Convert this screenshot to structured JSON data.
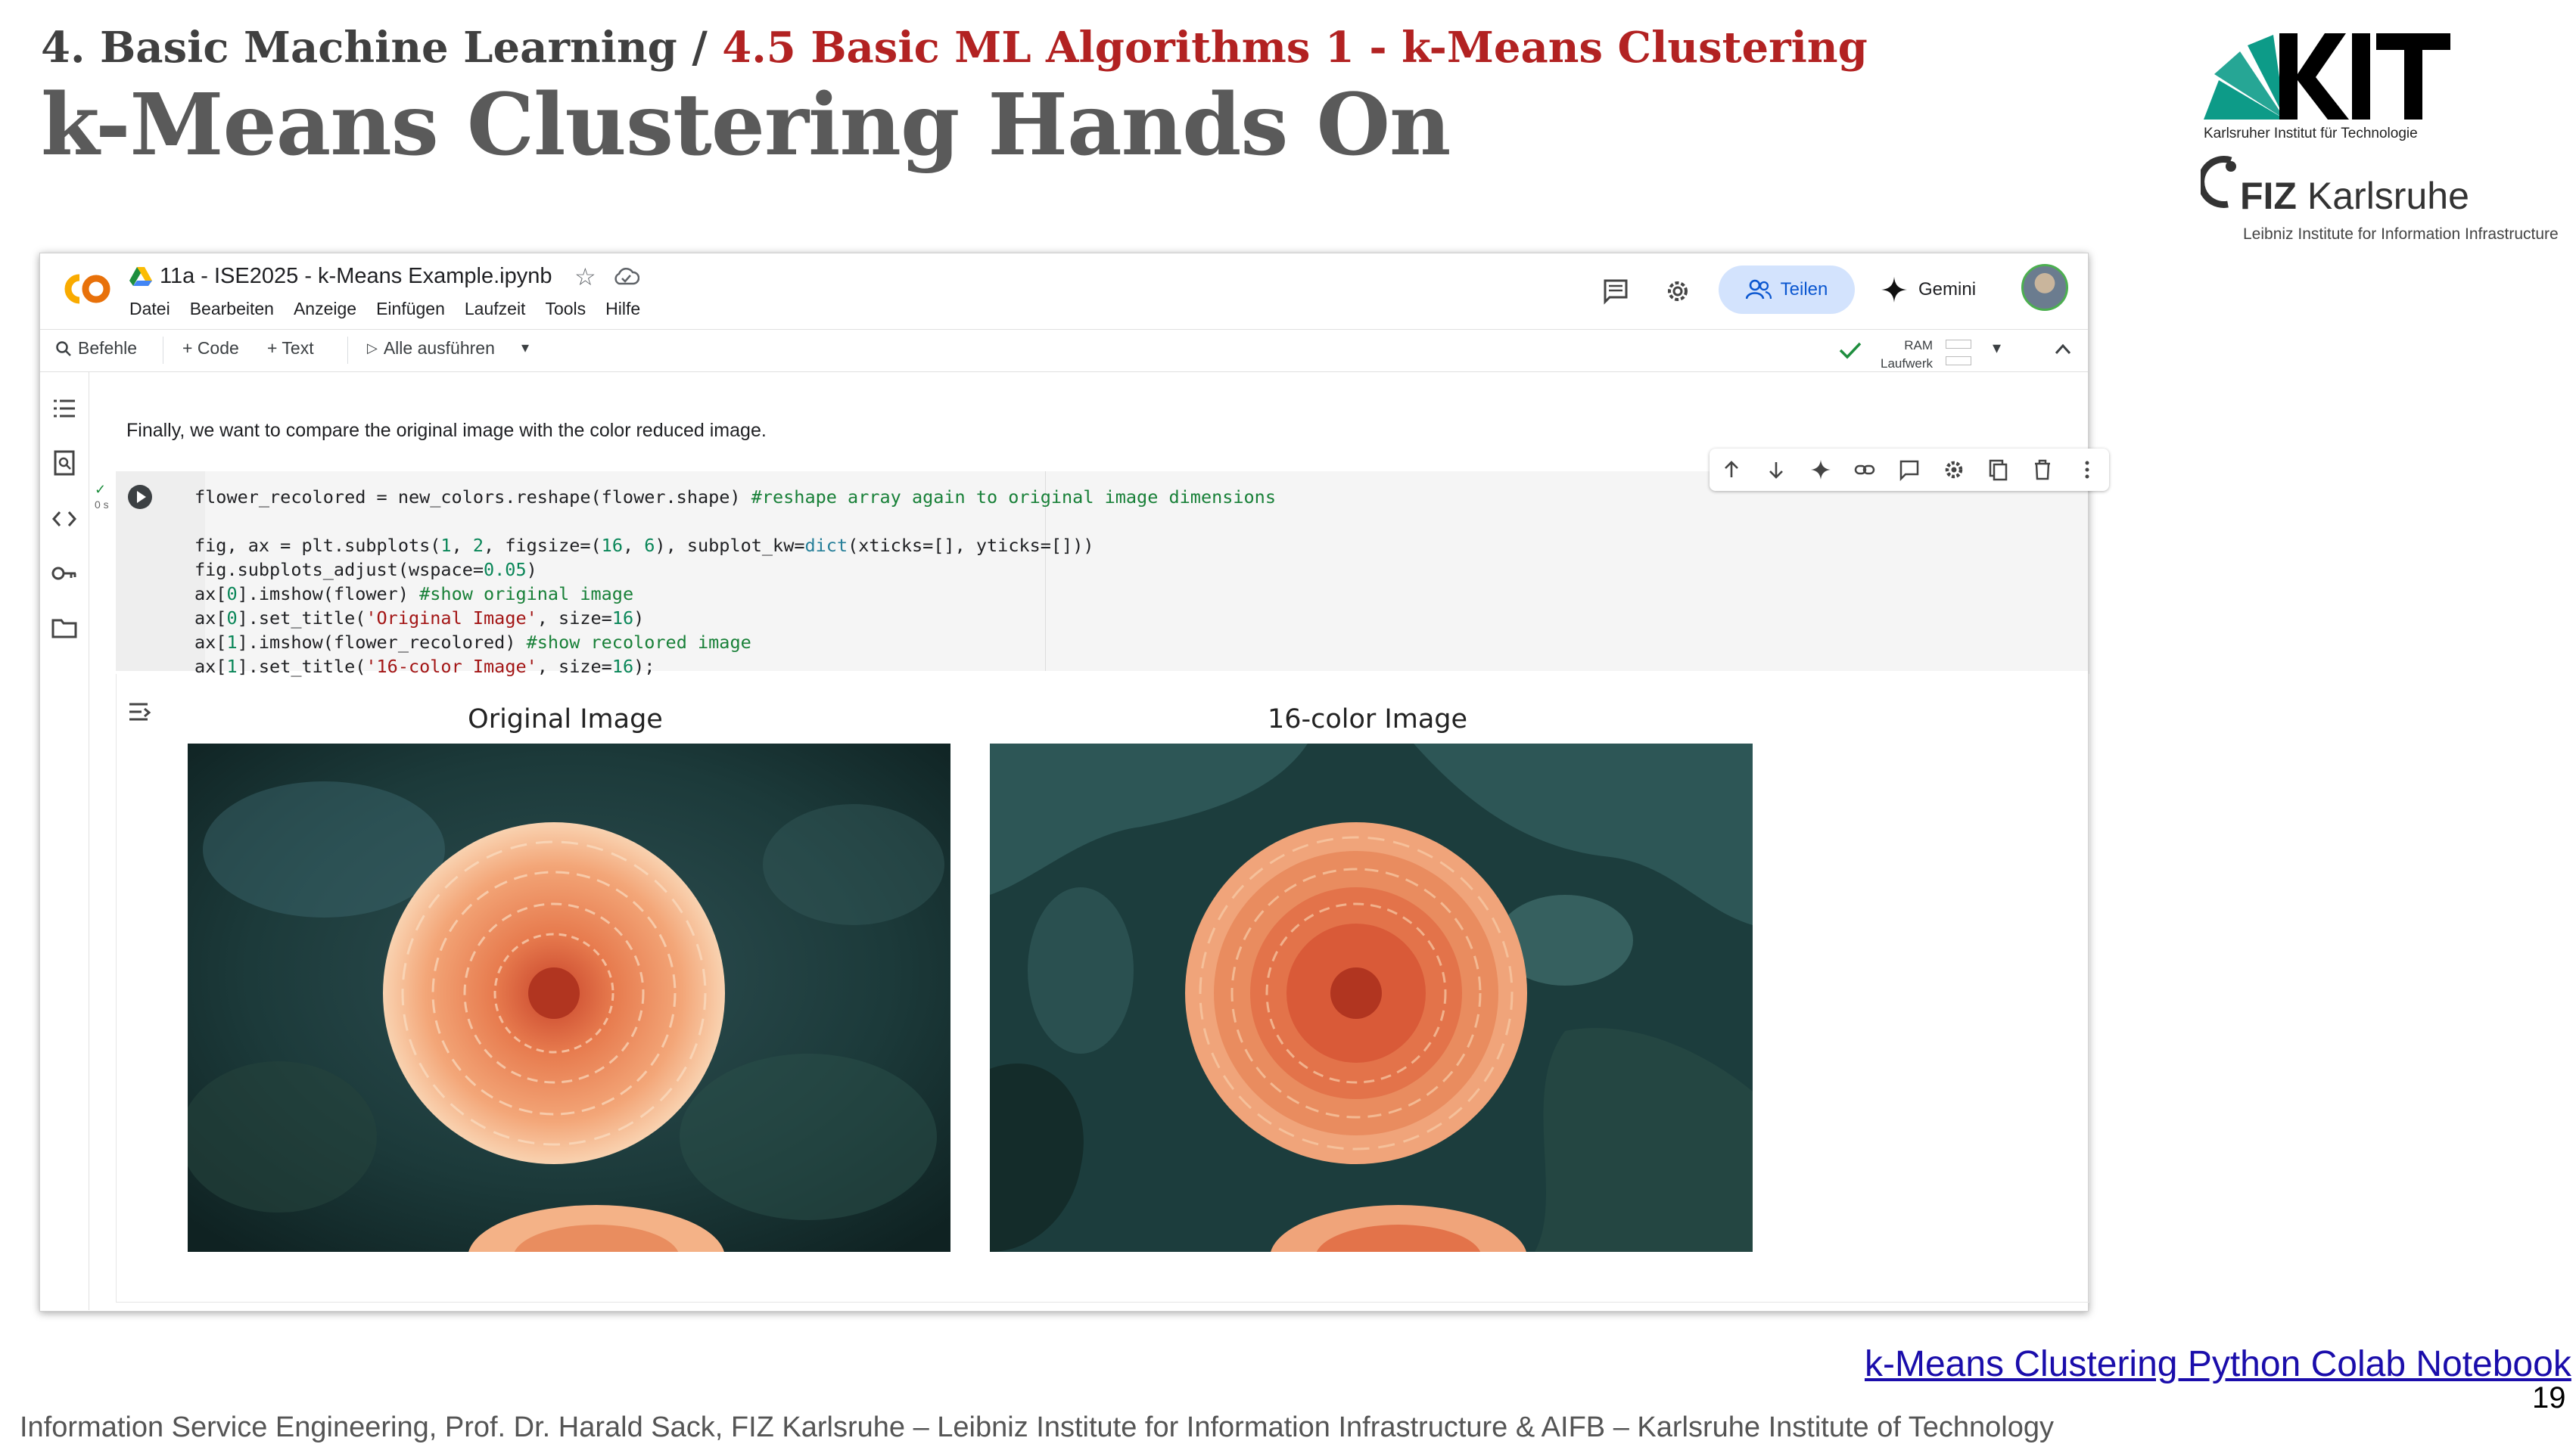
{
  "slide": {
    "breadcrumb_section": "4. Basic Machine Learning / ",
    "breadcrumb_topic": "4.5 Basic ML Algorithms 1 - k-Means Clustering",
    "title": "k-Means Clustering Hands On",
    "link_text": "k-Means Clustering Python Colab Notebook",
    "page_number": "19",
    "footer": "Information Service Engineering, Prof. Dr. Harald Sack, FIZ Karlsruhe – Leibniz Institute for Information Infrastructure & AIFB – Karlsruhe Institute of Technology"
  },
  "logos": {
    "kit_caption": "Karlsruher Institut für Technologie",
    "fiz_word_bold": "FIZ",
    "fiz_word": "Karlsruhe",
    "fiz_caption": "Leibniz Institute for Information Infrastructure",
    "kit_color": "#009682"
  },
  "colab": {
    "notebook_name": "11a - ISE2025 - k-Means Example.ipynb",
    "menu": [
      "Datei",
      "Bearbeiten",
      "Anzeige",
      "Einfügen",
      "Laufzeit",
      "Tools",
      "Hilfe"
    ],
    "share_label": "Teilen",
    "gemini_label": "Gemini",
    "toolbar": {
      "commands": "Befehle",
      "add_code": "+ Code",
      "add_text": "+ Text",
      "run_all": "Alle ausführen",
      "ram": "RAM",
      "disk": "Laufwerk"
    },
    "text_cell": "Finally, we want to compare the original image with the color reduced image.",
    "exec_time": "0 s",
    "output": {
      "left_title": "Original Image",
      "right_title": "16-color Image"
    },
    "accent": "#0b57d0",
    "share_bg": "#d3e3fd"
  }
}
